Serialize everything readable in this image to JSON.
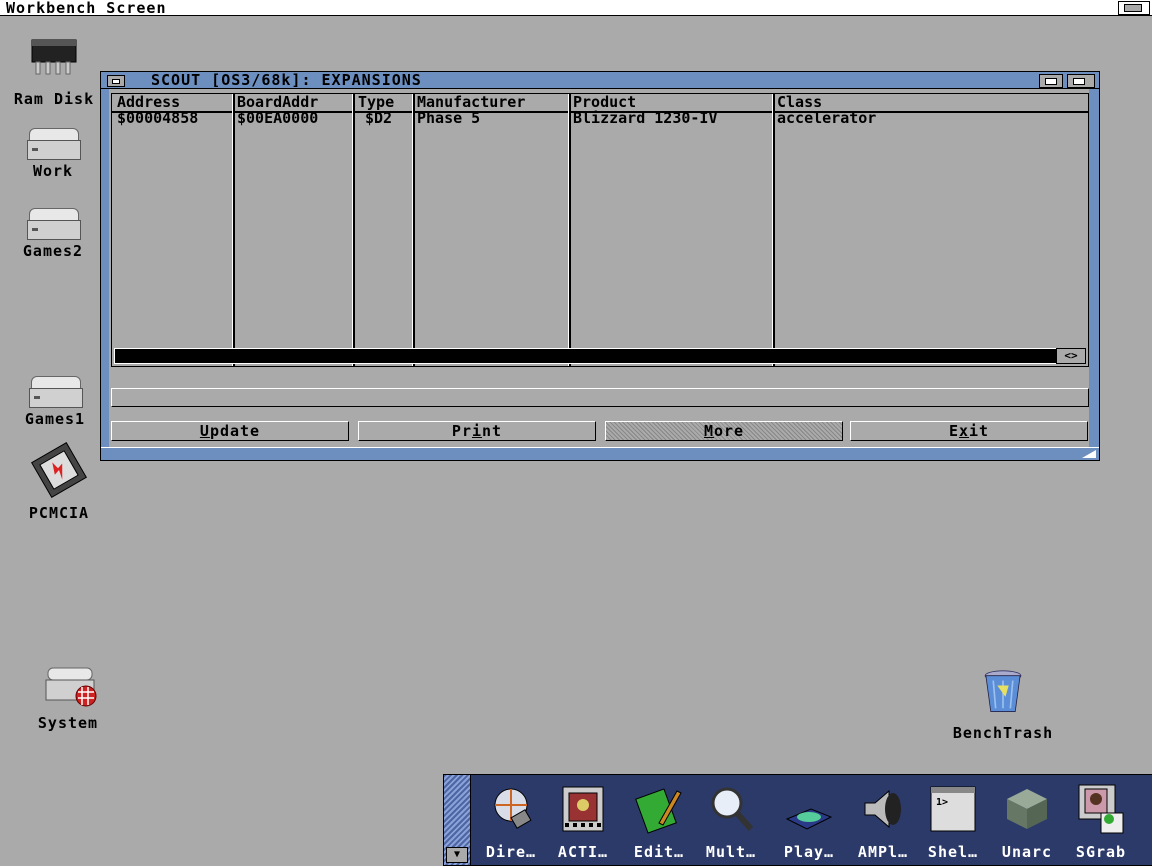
{
  "screen": {
    "title": "Workbench Screen"
  },
  "desktop_icons": [
    {
      "label": "Ram Disk"
    },
    {
      "label": "Work"
    },
    {
      "label": "Games2"
    },
    {
      "label": "Games1"
    },
    {
      "label": "PCMCIA"
    },
    {
      "label": "System"
    },
    {
      "label": "BenchTrash"
    }
  ],
  "window": {
    "title": "SCOUT [OS3/68k]: EXPANSIONS",
    "columns": [
      "Address",
      "BoardAddr",
      "Type",
      "Manufacturer",
      "Product",
      "Class"
    ],
    "rows": [
      [
        "$00004858",
        "$00EA0000",
        "$D2",
        "Phase 5",
        "Blizzard 1230-IV",
        "accelerator"
      ]
    ],
    "status_text": "",
    "buttons": [
      {
        "label": "Update",
        "hotkey": "U"
      },
      {
        "label": "Print",
        "hotkey": "i"
      },
      {
        "label": "More",
        "hotkey": "M",
        "disabled": true
      },
      {
        "label": "Exit",
        "hotkey": "x"
      }
    ]
  },
  "dock": {
    "items": [
      {
        "label": "Dire…",
        "icon": "dir-opus-icon"
      },
      {
        "label": "ACTI…",
        "icon": "film-icon"
      },
      {
        "label": "Edit…",
        "icon": "notepad-icon"
      },
      {
        "label": "Mult…",
        "icon": "magnifier-icon"
      },
      {
        "label": "Play…",
        "icon": "cd-player-icon"
      },
      {
        "label": "AMPl…",
        "icon": "speaker-icon"
      },
      {
        "label": "Shel…",
        "icon": "shell-icon"
      },
      {
        "label": "Unarc",
        "icon": "cube-icon"
      },
      {
        "label": "SGrab",
        "icon": "screengrab-icon"
      }
    ]
  },
  "colors": {
    "desktop": "#aaaaaa",
    "window_border": "#6d8fbf",
    "dock": "#2c3a6a"
  }
}
